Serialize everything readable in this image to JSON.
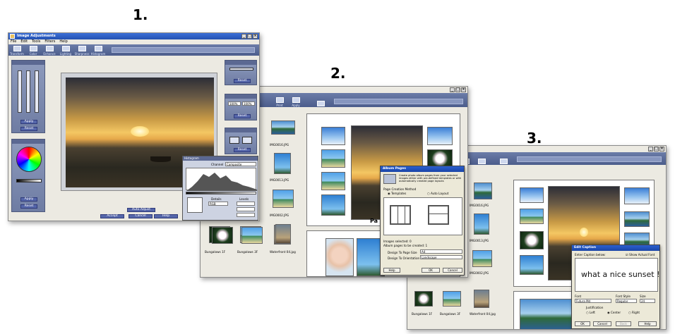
{
  "steps": [
    "1.",
    "2.",
    "3."
  ],
  "win1": {
    "title": "Image Adjustments",
    "menu": [
      "File",
      "Edit",
      "Tools",
      "Filters",
      "Help"
    ],
    "toolbar": [
      "Transform",
      "Color",
      "Enhance",
      "Lighting",
      "Sharpness",
      "Histogram"
    ],
    "buttons": {
      "apply": "Apply",
      "reset": "Reset",
      "auto_adjust": "Auto Adjust",
      "accept": "Accept",
      "cancel": "Cancel",
      "help": "Help"
    },
    "zoom_left": "100%",
    "zoom_right": "100%",
    "histogram": {
      "title": "Histogram",
      "channel_label": "Channel",
      "channel_value": "Composite",
      "mode_value": "RGB",
      "details_label": "Details",
      "levels_label": "Levels"
    }
  },
  "win2": {
    "toolbar": [
      "Print",
      "Apply",
      ""
    ],
    "list": [
      "IMG0016.JPG",
      "IMG0013.JPG",
      "IMG0002.JPG"
    ],
    "bottom_thumbs": [
      "Bungalows 1F",
      "Bungalows 3F",
      "Waterfront 04.jpg"
    ],
    "page_label": "Pa",
    "dialog": {
      "title": "Album Pages",
      "description": "Create photo album pages from your selected images either with pre-defined templates or with automatically created page layouts",
      "method_label": "Page Creation Method",
      "opt_templates": "Templates",
      "opt_auto": "Auto Layout",
      "images_selected": "Images selected: 0",
      "pages_created": "Album pages to be created: 1",
      "page_size_label": "Design To Page Size",
      "page_size_value": "A4",
      "orientation_label": "Design To Orientation",
      "orientation_value": "Landscape",
      "help": "Help",
      "ok": "OK",
      "cancel": "Cancel"
    }
  },
  "win3": {
    "list": [
      "IMG0016.JPG",
      "IMG0013.JPG",
      "IMG0002.JPG"
    ],
    "bottom_thumbs": [
      "Bungalows 1F",
      "Bungalows 3F",
      "Waterfront 04.jpg"
    ],
    "dialog": {
      "title": "Edit Caption",
      "enter_label": "Enter Caption below:",
      "show_font": "Show Actual Font",
      "caption": "what a nice sunset !",
      "font_label": "Font",
      "font_value": "Futura Md",
      "style_label": "Font Style",
      "style_value": "Regular",
      "size_label": "Size",
      "size_value": "24",
      "justification_label": "Justification",
      "left": "Left",
      "center": "Center",
      "right": "Right",
      "ok": "OK",
      "cancel": "Cancel",
      "back": "Back",
      "help": "Help"
    }
  }
}
